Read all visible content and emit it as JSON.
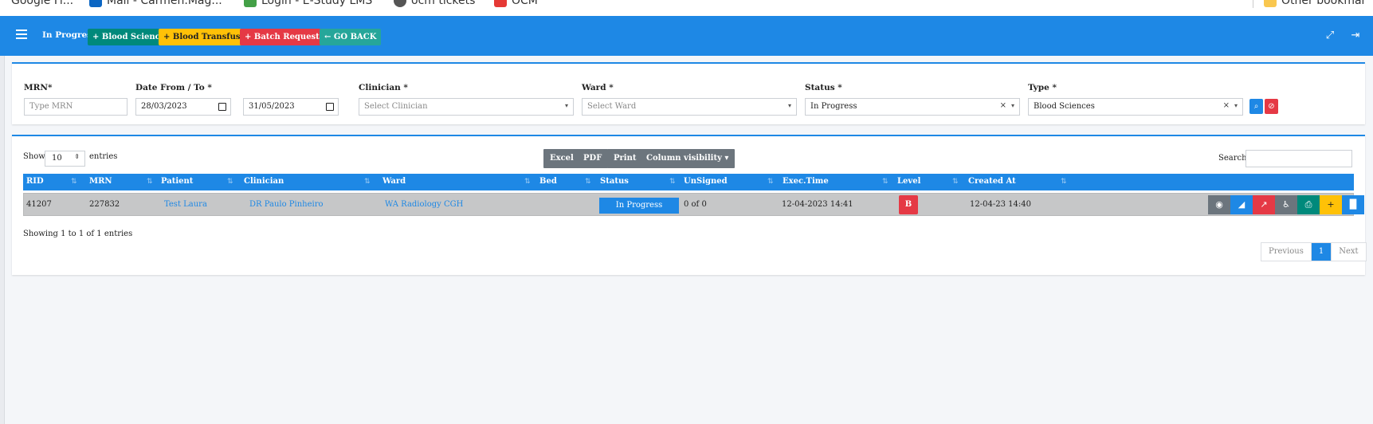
{
  "bookmarks": [
    {
      "label": "Google Fi...",
      "color": "#bdbdbd"
    },
    {
      "label": "Mail - Carmen.Mag...",
      "color": "#0b66c3"
    },
    {
      "label": "Login - E-Study LMS",
      "color": "#43a047"
    },
    {
      "label": "ocm tickets",
      "color": "#555555"
    },
    {
      "label": "OCM",
      "color": "#e53935"
    },
    {
      "label": "Other bookmar",
      "color": "#f9c74f"
    }
  ],
  "navbar": {
    "title": "In Progress",
    "buttons": [
      {
        "label": "+ Blood Sciences",
        "color": "#00897b"
      },
      {
        "label": "+ Blood Transfusion",
        "color": "#ffc107"
      },
      {
        "label": "+ Batch Requesting",
        "color": "#e53945"
      },
      {
        "label": "← GO BACK",
        "color": "#26a69a"
      }
    ],
    "expand_icon": "⤢",
    "logout_icon": "⇥"
  },
  "filters": {
    "mrn": {
      "label": "MRN*",
      "placeholder": "Type MRN"
    },
    "date": {
      "label": "Date From / To *",
      "from": "28/03/2023",
      "to": "31/05/2023"
    },
    "clinician": {
      "label": "Clinician *",
      "placeholder": "Select Clinician"
    },
    "ward": {
      "label": "Ward *",
      "placeholder": "Select Ward"
    },
    "status": {
      "label": "Status *",
      "value": "In Progress"
    },
    "type": {
      "label": "Type *",
      "value": "Blood Sciences"
    },
    "search_icon": "⌕",
    "reset_icon": "⊘"
  },
  "table": {
    "show_label": "Show",
    "entries_value": "10",
    "entries_label": "entries",
    "export_buttons": [
      "Excel",
      "PDF",
      "Print",
      "Column visibility ▾"
    ],
    "search_label": "Search:",
    "columns": [
      "RID",
      "MRN",
      "Patient",
      "Clinician",
      "Ward",
      "Bed",
      "Status",
      "UnSigned",
      "Exec.Time",
      "Level",
      "Created At"
    ],
    "rows": [
      {
        "rid": "41207",
        "mrn": "227832",
        "patient": "Test Laura",
        "clinician": "DR Paulo Pinheiro",
        "ward": "WA Radiology CGH",
        "bed": "",
        "status": "In Progress",
        "unsigned": "0 of 0",
        "exec_time": "12-04-2023 14:41",
        "level": "B",
        "created_at": "12-04-23 14:40"
      }
    ],
    "action_icons": [
      {
        "name": "view-icon",
        "glyph": "◉",
        "color": "#6c757d"
      },
      {
        "name": "area-chart-icon",
        "glyph": "◢",
        "color": "#1e88e5"
      },
      {
        "name": "line-chart-icon",
        "glyph": "↗",
        "color": "#e53945"
      },
      {
        "name": "wheelchair-icon",
        "glyph": "♿",
        "color": "#6c757d"
      },
      {
        "name": "print-icon",
        "glyph": "⎙",
        "color": "#00897b"
      },
      {
        "name": "plus-icon",
        "glyph": "+",
        "color": "#ffc107"
      },
      {
        "name": "barcode-icon",
        "glyph": "▐▌",
        "color": "#1e88e5"
      }
    ],
    "info": "Showing 1 to 1 of 1 entries",
    "pagination": {
      "previous": "Previous",
      "current": "1",
      "next": "Next"
    }
  }
}
